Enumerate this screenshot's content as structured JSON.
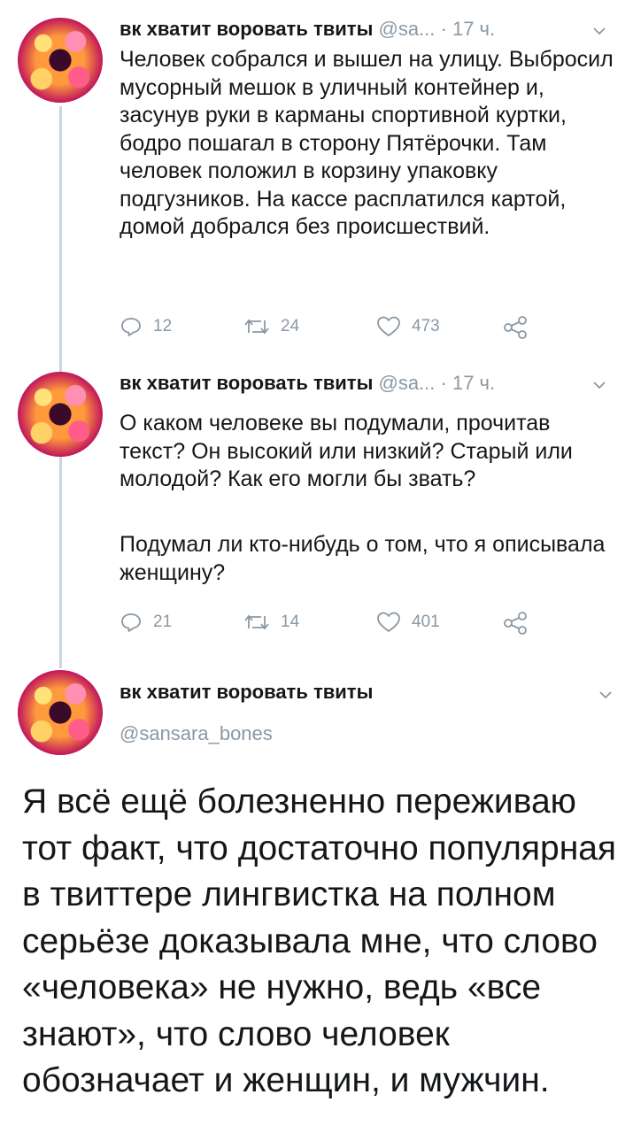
{
  "tweets": [
    {
      "name": "вк хватит воровать твиты",
      "handle_short": "@sa...",
      "time": "· 17 ч.",
      "text": "Человек собрался и вышел на улицу. Выбросил мусорный мешок в уличный контейнер и, засунув руки в карманы спортивной куртки, бодро пошагал в сторону Пятёрочки. Там человек положил в корзину упаковку подгузников. На кассе расплатился картой, домой добрался без происшествий.",
      "replies": "12",
      "retweets": "24",
      "likes": "473"
    },
    {
      "name": "вк хватит воровать твиты",
      "handle_short": "@sa...",
      "time": "· 17 ч.",
      "text_p1": "О каком человеке вы подумали, прочитав текст? Он высокий или низкий? Старый или молодой? Как его могли бы звать?",
      "text_p2": "Подумал ли кто-нибудь о том, что я описывала женщину?",
      "replies": "21",
      "retweets": "14",
      "likes": "401"
    }
  ],
  "main_tweet": {
    "name": "вк хватит воровать твиты",
    "handle": "@sansara_bones",
    "text": "Я всё ещё болезненно переживаю тот факт, что достаточно популярная в твиттере лингвистка на полном серьёзе доказывала мне, что слово «человека» не нужно, ведь «все знают», что слово человек обозначает и женщин, и мужчин."
  },
  "colors": {
    "text": "#14171a",
    "secondary": "#8a98a4",
    "thread_line": "#ccd6dd"
  },
  "icons": [
    "reply-icon",
    "retweet-icon",
    "like-icon",
    "share-icon",
    "chevron-down-icon"
  ]
}
